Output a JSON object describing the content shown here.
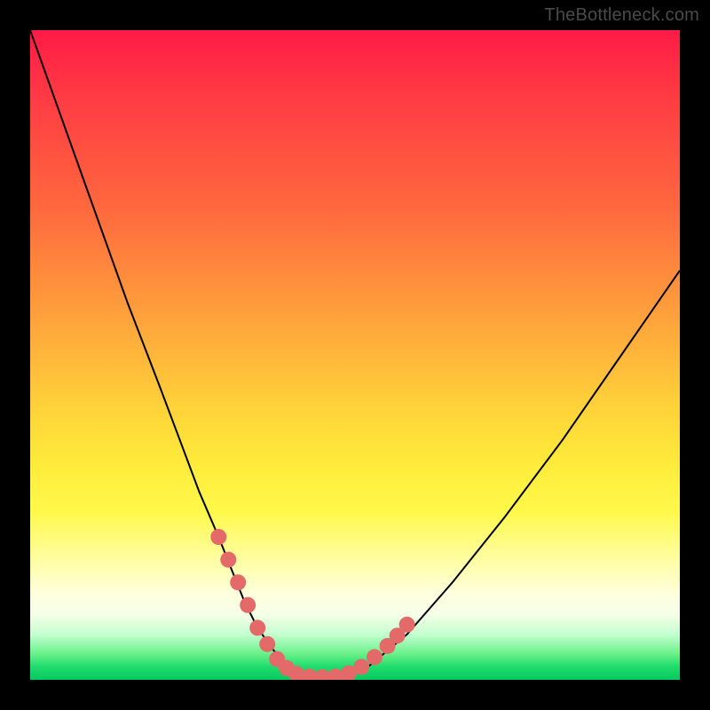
{
  "watermark": "TheBottleneck.com",
  "colors": {
    "frame": "#000000",
    "curve": "#000000",
    "marker": "#e46a6a",
    "gradient_stops": [
      "#ff1b46",
      "#ff3a44",
      "#ff6a3e",
      "#ff9a3c",
      "#ffd23a",
      "#ffe93a",
      "#fff94a",
      "#fffea8",
      "#ffffe0",
      "#f4ffe6",
      "#c4ffd0",
      "#6af08a",
      "#1fdc6d",
      "#06c95e"
    ]
  },
  "chart_data": {
    "type": "line",
    "title": "",
    "xlabel": "",
    "ylabel": "",
    "xlim": [
      0,
      100
    ],
    "ylim": [
      0,
      100
    ],
    "series": [
      {
        "name": "bottleneck-curve",
        "x": [
          0,
          5,
          10,
          15,
          20,
          23,
          26,
          29,
          31,
          33,
          35,
          37.5,
          40,
          42.5,
          45,
          48,
          52,
          58,
          65,
          73,
          82,
          91,
          100
        ],
        "y": [
          100,
          86,
          72,
          58,
          45,
          37,
          29,
          22,
          17,
          12,
          8,
          4.5,
          2,
          0.7,
          0.3,
          0.5,
          2,
          7,
          15,
          25,
          37,
          50,
          63
        ]
      }
    ],
    "markers": [
      {
        "name": "left-cluster",
        "points": [
          {
            "x": 29,
            "y": 22
          },
          {
            "x": 30.5,
            "y": 18.5
          },
          {
            "x": 32,
            "y": 15
          },
          {
            "x": 33.5,
            "y": 11.5
          },
          {
            "x": 35,
            "y": 8
          },
          {
            "x": 36.5,
            "y": 5.5
          },
          {
            "x": 38,
            "y": 3.2
          },
          {
            "x": 39.5,
            "y": 1.8
          },
          {
            "x": 41,
            "y": 0.9
          },
          {
            "x": 43,
            "y": 0.5
          },
          {
            "x": 45,
            "y": 0.4
          },
          {
            "x": 47,
            "y": 0.5
          }
        ]
      },
      {
        "name": "right-cluster",
        "points": [
          {
            "x": 49,
            "y": 1.0
          },
          {
            "x": 51,
            "y": 2.0
          },
          {
            "x": 53,
            "y": 3.5
          },
          {
            "x": 55,
            "y": 5.2
          },
          {
            "x": 56.5,
            "y": 6.8
          },
          {
            "x": 58,
            "y": 8.5
          }
        ]
      }
    ]
  }
}
